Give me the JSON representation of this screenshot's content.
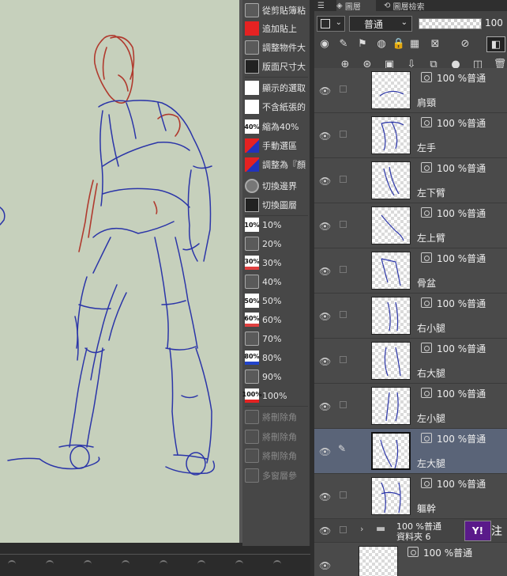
{
  "colors": {
    "canvas": "#c6d0bc",
    "blue_stroke": "#2b35a8",
    "red_stroke": "#b03a2e",
    "selection": "#5a6478"
  },
  "commands": [
    {
      "icon": "folder-icon",
      "type": "folder",
      "label": "從剪貼簿粘"
    },
    {
      "icon": "red-swatch-icon",
      "type": "red",
      "label": "追加貼上"
    },
    {
      "icon": "folder-icon",
      "type": "folder",
      "label": "調整物件大"
    },
    {
      "icon": "resize-icon",
      "type": "dbl",
      "label": "版面尺寸大"
    },
    {
      "icon": "document-icon",
      "type": "doc",
      "label": "顯示的選取"
    },
    {
      "icon": "document-icon",
      "type": "doc",
      "label": "不含紙張的"
    },
    {
      "icon": "zoom-40-icon",
      "type": "pct",
      "text": "40%",
      "label": "縮為40%"
    },
    {
      "icon": "red-blue-icon",
      "type": "rb",
      "label": "手動選區"
    },
    {
      "icon": "red-blue-icon",
      "type": "rb",
      "label": "調整為『顏"
    },
    {
      "icon": "circle-icon",
      "type": "circle",
      "label": "切換邊界"
    },
    {
      "icon": "layer-toggle-icon",
      "type": "dbl",
      "label": "切換圖層"
    },
    {
      "icon": "percent-10-icon",
      "type": "pct",
      "text": "10%",
      "label": "10%"
    },
    {
      "icon": "folder-icon",
      "type": "folder",
      "label": "20%"
    },
    {
      "icon": "percent-30-icon",
      "type": "pct",
      "text": "30%",
      "label": "30%"
    },
    {
      "icon": "folder-icon",
      "type": "folder",
      "label": "40%"
    },
    {
      "icon": "percent-50-icon",
      "type": "pct",
      "text": "50%",
      "label": "50%"
    },
    {
      "icon": "percent-60-icon",
      "type": "pct",
      "text": "60%",
      "label": "60%"
    },
    {
      "icon": "folder-icon",
      "type": "folder",
      "label": "70%"
    },
    {
      "icon": "percent-80-icon",
      "type": "pct",
      "text": "80%",
      "label": "80%"
    },
    {
      "icon": "folder-icon",
      "type": "folder",
      "label": "90%"
    },
    {
      "icon": "percent-100-icon",
      "type": "pct",
      "text": "100%",
      "label": "100%"
    },
    {
      "icon": "delete-icon",
      "type": "none",
      "label": "將刪除角",
      "disabled": true
    },
    {
      "icon": "delete-icon",
      "type": "none",
      "label": "將刪除角",
      "disabled": true
    },
    {
      "icon": "delete-icon",
      "type": "none",
      "label": "將刪除角",
      "disabled": true
    },
    {
      "icon": "multi-layer-icon",
      "type": "none",
      "label": "多窗層參",
      "disabled": true
    }
  ],
  "layer_panel": {
    "tabs": [
      "圖層",
      "圖層檢索"
    ],
    "blend_mode": "普通",
    "opacity": "100",
    "layers": [
      {
        "name": "肩頸",
        "opacity": "100 %普通",
        "selected": false
      },
      {
        "name": "左手",
        "opacity": "100 %普通",
        "selected": false
      },
      {
        "name": "左下臂",
        "opacity": "100 %普通",
        "selected": false
      },
      {
        "name": "左上臂",
        "opacity": "100 %普通",
        "selected": false
      },
      {
        "name": "骨盆",
        "opacity": "100 %普通",
        "selected": false
      },
      {
        "name": "右小腿",
        "opacity": "100 %普通",
        "selected": false
      },
      {
        "name": "右大腿",
        "opacity": "100 %普通",
        "selected": false
      },
      {
        "name": "左小腿",
        "opacity": "100 %普通",
        "selected": false
      },
      {
        "name": "左大腿",
        "opacity": "100 %普通",
        "selected": true
      },
      {
        "name": "軀幹",
        "opacity": "100 %普通",
        "selected": false
      }
    ],
    "folder": {
      "name": "資料夾 6",
      "opacity": "100 %普通"
    },
    "bottom_layer": {
      "opacity": "100 %普通"
    },
    "yahoo_badge": "Y!",
    "yahoo_text": "注"
  }
}
